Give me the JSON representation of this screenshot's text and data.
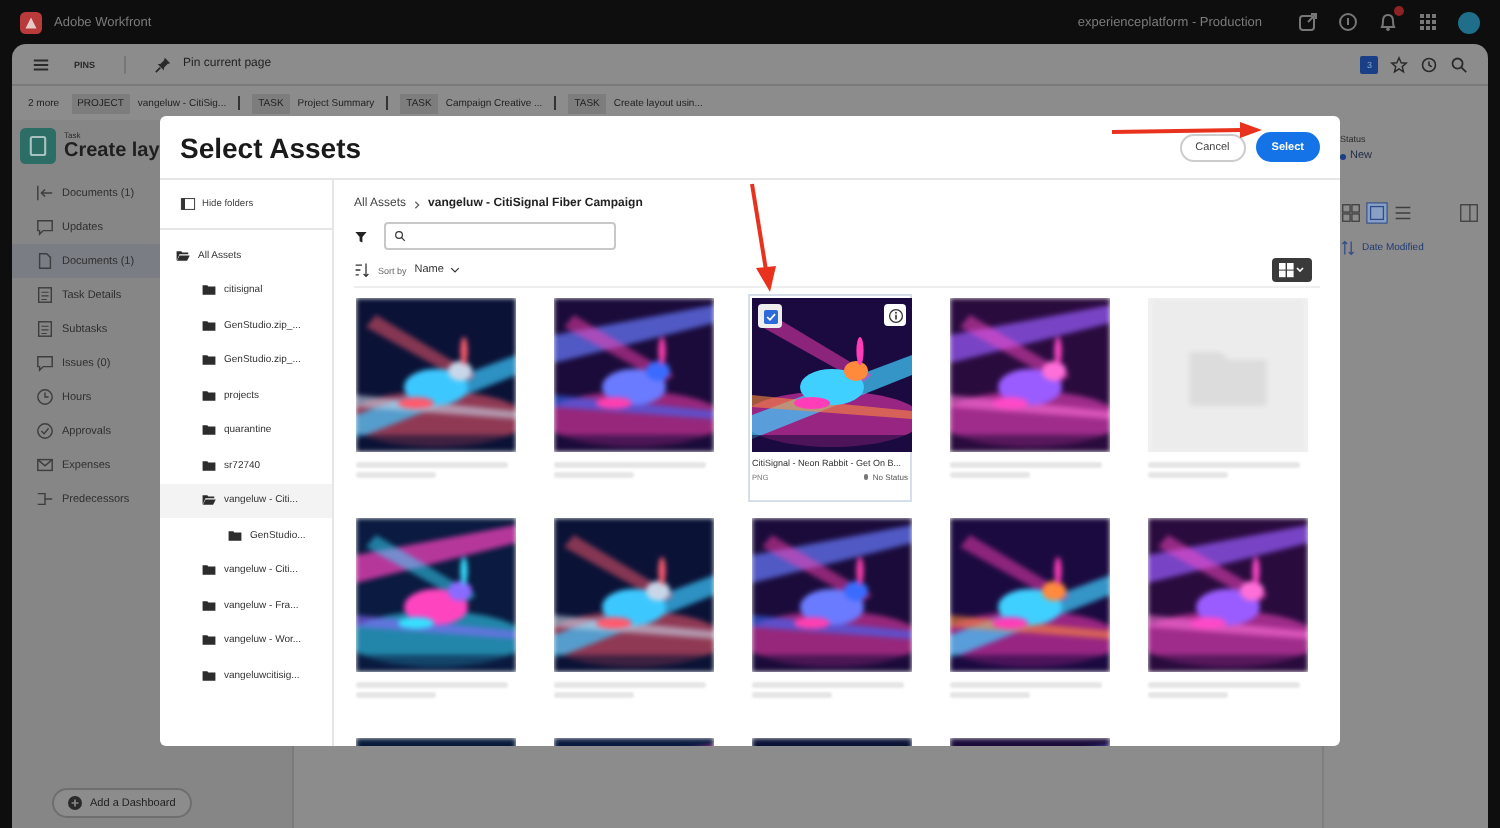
{
  "topbar": {
    "app_name": "Adobe Workfront",
    "environment": "experienceplatform - Production"
  },
  "header": {
    "pins_label": "PINS",
    "pin_action": "Pin current page",
    "count_badge": "3"
  },
  "breadcrumb": {
    "more": "2 more",
    "items": [
      {
        "type": "PROJECT",
        "name": "vangeluw - CitiSig..."
      },
      {
        "type": "TASK",
        "name": "Project Summary"
      },
      {
        "type": "TASK",
        "name": "Campaign Creative ..."
      },
      {
        "type": "TASK",
        "name": "Create layout usin..."
      }
    ]
  },
  "task": {
    "kind_label": "Task",
    "title": "Create lay"
  },
  "sidebar": {
    "items": [
      {
        "label": "Documents (1)",
        "kind": "back",
        "selected": false
      },
      {
        "label": "Updates",
        "kind": "chat",
        "selected": false
      },
      {
        "label": "Documents (1)",
        "kind": "doc",
        "selected": true
      },
      {
        "label": "Task Details",
        "kind": "list",
        "selected": false
      },
      {
        "label": "Subtasks",
        "kind": "list",
        "selected": false
      },
      {
        "label": "Issues (0)",
        "kind": "chat",
        "selected": false
      },
      {
        "label": "Hours",
        "kind": "clock",
        "selected": false
      },
      {
        "label": "Approvals",
        "kind": "check",
        "selected": false
      },
      {
        "label": "Expenses",
        "kind": "mail",
        "selected": false
      },
      {
        "label": "Predecessors",
        "kind": "link",
        "selected": false
      }
    ],
    "add_dashboard": "Add a Dashboard"
  },
  "details": {
    "status_label": "Status",
    "status": "New",
    "sort": "Date Modified"
  },
  "modal": {
    "title": "Select Assets",
    "cancel": "Cancel",
    "select": "Select",
    "hide_folders": "Hide folders",
    "folders": [
      {
        "label": "All Assets",
        "expanded": true,
        "selected": false,
        "children": [
          {
            "label": "citisignal",
            "expanded": false,
            "selected": false
          },
          {
            "label": "GenStudio.zip_...",
            "expanded": false,
            "selected": false
          },
          {
            "label": "GenStudio.zip_...",
            "expanded": false,
            "selected": false
          },
          {
            "label": "projects",
            "expanded": false,
            "selected": false
          },
          {
            "label": "quarantine",
            "expanded": false,
            "selected": false
          },
          {
            "label": "sr72740",
            "expanded": false,
            "selected": false
          },
          {
            "label": "vangeluw - Citi...",
            "expanded": true,
            "selected": true,
            "children": [
              {
                "label": "GenStudio...",
                "expanded": false,
                "selected": false
              }
            ]
          },
          {
            "label": "vangeluw - Citi...",
            "expanded": false,
            "selected": false
          },
          {
            "label": "vangeluw - Fra...",
            "expanded": false,
            "selected": false
          },
          {
            "label": "vangeluw - Wor...",
            "expanded": false,
            "selected": false
          },
          {
            "label": "vangeluwcitisig...",
            "expanded": false,
            "selected": false
          }
        ]
      }
    ],
    "path_root": "All Assets",
    "path_current": "vangeluw - CitiSignal Fiber Campaign",
    "sort_label": "Sort by",
    "sort_value": "Name",
    "assets": [
      {
        "kind": "picture",
        "selected": false
      },
      {
        "kind": "picture",
        "selected": false
      },
      {
        "kind": "picture",
        "selected": true,
        "name": "CitiSignal - Neon Rabbit - Get On B...",
        "format": "PNG",
        "status": "No Status"
      },
      {
        "kind": "picture",
        "selected": false
      },
      {
        "kind": "placeholder",
        "selected": false
      },
      {
        "kind": "picture",
        "selected": false
      },
      {
        "kind": "picture",
        "selected": false
      },
      {
        "kind": "picture",
        "selected": false
      },
      {
        "kind": "picture",
        "selected": false
      },
      {
        "kind": "picture",
        "selected": false
      },
      {
        "kind": "picture",
        "selected": false
      },
      {
        "kind": "picture",
        "selected": false
      },
      {
        "kind": "picture",
        "selected": false
      },
      {
        "kind": "picture",
        "selected": false
      }
    ]
  }
}
